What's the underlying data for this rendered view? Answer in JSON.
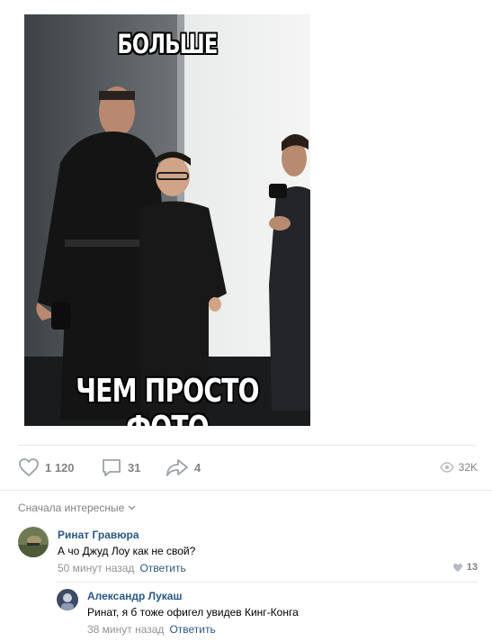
{
  "post": {
    "image": {
      "top_caption": "БОЛЬШЕ",
      "bottom_caption": "ЧЕМ ПРОСТО ФОТО"
    },
    "actions": {
      "likes": "1 120",
      "comments": "31",
      "shares": "4",
      "views": "32K"
    }
  },
  "comments_section": {
    "sort_label": "Сначала интересные"
  },
  "comments": [
    {
      "author": "Ринат Гравюра",
      "text": "А чо Джуд Лоу как не свой?",
      "time": "50 минут назад",
      "reply_label": "Ответить",
      "likes": "13"
    },
    {
      "author": "Александр Лукаш",
      "text": "Ринат, я б тоже офигел увидев Кинг-Конга",
      "time": "38 минут назад",
      "reply_label": "Ответить"
    }
  ],
  "colors": {
    "link": "#2a5885",
    "meta": "#939393",
    "icon": "#99a2ad",
    "divider": "#e7e8ec"
  }
}
